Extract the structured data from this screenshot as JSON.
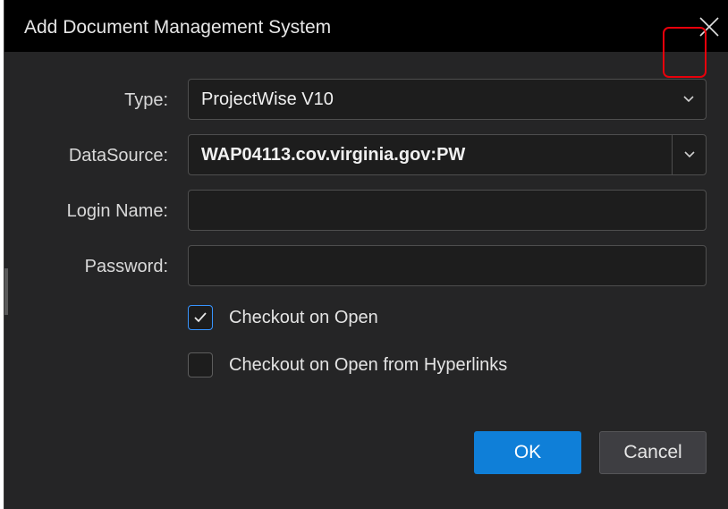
{
  "dialog": {
    "title": "Add Document Management System"
  },
  "form": {
    "type_label": "Type:",
    "type_value": "ProjectWise V10",
    "datasource_label": "DataSource:",
    "datasource_value": "WAP04113.cov.virginia.gov:PW",
    "login_label": "Login Name:",
    "login_value": "",
    "password_label": "Password:",
    "password_value": ""
  },
  "options": {
    "checkout_open_label": "Checkout on Open",
    "checkout_open_checked": true,
    "checkout_hyperlinks_label": "Checkout on Open from Hyperlinks",
    "checkout_hyperlinks_checked": false
  },
  "buttons": {
    "ok_label": "OK",
    "cancel_label": "Cancel"
  },
  "colors": {
    "accent": "#0f7fd8",
    "highlight_annotation": "#e8000b",
    "background": "#252526",
    "titlebar": "#000000"
  },
  "icons": {
    "close": "close-icon",
    "dropdown": "chevron-down-icon",
    "check": "checkmark-icon"
  }
}
